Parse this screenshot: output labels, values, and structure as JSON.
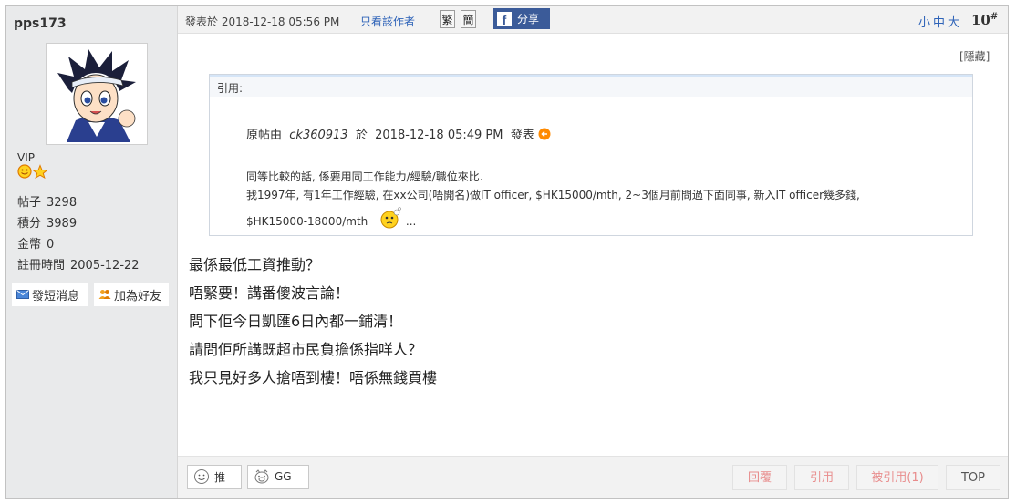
{
  "user": {
    "name": "pps173",
    "level": "VIP",
    "stats": [
      {
        "label": "帖子",
        "value": "3298"
      },
      {
        "label": "積分",
        "value": "3989"
      },
      {
        "label": "金幣",
        "value": "0"
      },
      {
        "label": "註冊時間",
        "value": "2005-12-22"
      }
    ],
    "send_pm": "發短消息",
    "add_friend": "加為好友"
  },
  "post": {
    "posted": "發表於 2018-12-18 05:56 PM",
    "only_author": "只看該作者",
    "trad": "繁",
    "simp": "簡",
    "share": "分享",
    "font_size": "小中大",
    "floor": "10",
    "floor_mark": "#",
    "hide": "[隱藏]",
    "quote": {
      "label": "引用:",
      "meta_prefix": "原帖由",
      "meta_user": "ck360913",
      "meta_mid": "於",
      "meta_date": "2018-12-18  05:49  PM",
      "meta_suffix": "發表",
      "line1": "同等比較的話, 係要用同工作能力/經驗/職位來比.",
      "line2": "我1997年, 有1年工作經驗, 在xx公司(唔開名)做IT  officer, $HK15000/mth, 2~3個月前問過下面同事, 新入IT  officer幾多錢,",
      "line3": "$HK15000-18000/mth",
      "ellipsis": "..."
    },
    "body": [
      "最係最低工資推動？",
      "唔緊要！講番傻波言論！",
      "問下佢今日凱匯6日內都一鋪清！",
      "請問佢所講既超市民負擔係指咩人？",
      "我只見好多人搶唔到樓！唔係無錢買樓"
    ],
    "rate_up": "推",
    "rate_gg": "GG",
    "reply": "回覆",
    "cite": "引用",
    "cited": "被引用(1)",
    "top": "TOP"
  },
  "colors": {
    "link": "#2e63b8",
    "sidebar": "#e9eaeb",
    "facebook": "#3b5b99",
    "action_text": "#e88c8c"
  }
}
